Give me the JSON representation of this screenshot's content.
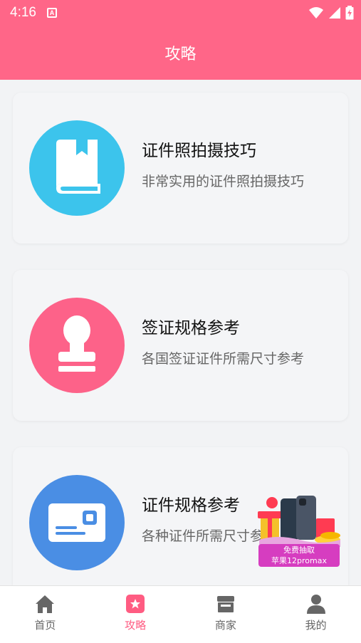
{
  "status_bar": {
    "time": "4:16",
    "notification_badge": "A"
  },
  "header": {
    "title": "攻略"
  },
  "cards": [
    {
      "title": "证件照拍摄技巧",
      "desc": "非常实用的证件照拍摄技巧",
      "icon": "book-icon",
      "color": "#3cc4ec"
    },
    {
      "title": "签证规格参考",
      "desc": "各国签证证件所需尺寸参考",
      "icon": "stamp-icon",
      "color": "#fd6289"
    },
    {
      "title": "证件规格参考",
      "desc": "各种证件所需尺寸参考",
      "icon": "id-card-icon",
      "color": "#4a8ee4"
    }
  ],
  "promo": {
    "line1": "免费抽取",
    "line2": "苹果12promax"
  },
  "tabbar": {
    "tabs": [
      {
        "label": "首页",
        "icon": "home-icon"
      },
      {
        "label": "攻略",
        "icon": "guide-icon"
      },
      {
        "label": "商家",
        "icon": "store-icon"
      },
      {
        "label": "我的",
        "icon": "user-icon"
      }
    ],
    "active_color": "#ff5c82"
  },
  "colors": {
    "header": "#ff6688",
    "background": "#f2f3f5"
  }
}
